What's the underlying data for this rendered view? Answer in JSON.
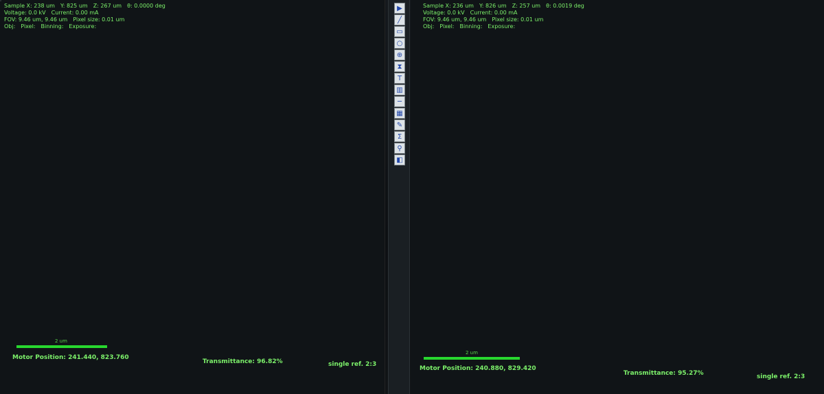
{
  "left": {
    "sample_line": [
      "Sample X: 238 um",
      "Y: 825 um",
      "Z: 267 um",
      "θ: 0.0000 deg"
    ],
    "voltage_line": [
      "Voltage: 0.0 kV",
      "Current: 0.00 mA"
    ],
    "fov_line": [
      "FOV: 9.46 um, 9.46 um",
      "Pixel size: 0.01 um"
    ],
    "obj_line": [
      "Obj:",
      "Pixel:",
      "Binning:",
      "Exposure:"
    ],
    "motor_position": "Motor Position:  241.440, 823.760",
    "transmittance": "Transmittance:  96.82%",
    "ref": "single ref. 2:3",
    "scale_label": "2 um"
  },
  "right": {
    "sample_line": [
      "Sample X: 236 um",
      "Y: 826 um",
      "Z: 257 um",
      "θ: 0.0019 deg"
    ],
    "voltage_line": [
      "Voltage: 0.0 kV",
      "Current: 0.00 mA"
    ],
    "fov_line": [
      "FOV: 9.46 um, 9.46 um",
      "Pixel size: 0.01 um"
    ],
    "obj_line": [
      "Obj:",
      "Pixel:",
      "Binning:",
      "Exposure:"
    ],
    "motor_position": "Motor Position:  240.880, 829.420",
    "transmittance": "Transmittance:  95.27%",
    "ref": "single ref. 2:3",
    "scale_label": "2 um"
  },
  "toolbar": [
    "pointer-icon",
    "line-icon",
    "rectangle-icon",
    "circle-icon",
    "crosshair-icon",
    "hourglass-icon",
    "text-icon",
    "histogram-icon",
    "hline-icon",
    "grid-icon",
    "pen-icon",
    "sigma-icon",
    "zoom-icon",
    "contrast-icon"
  ]
}
